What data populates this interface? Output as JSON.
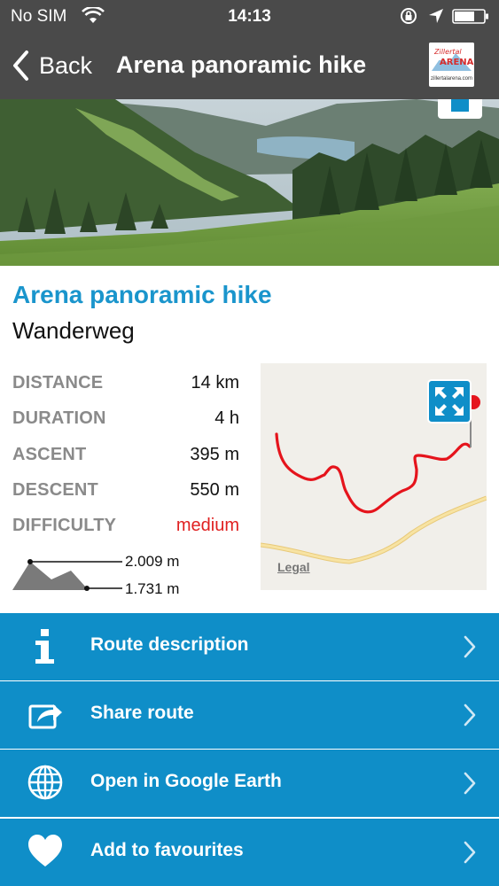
{
  "status_bar": {
    "carrier": "No SIM",
    "time": "14:13",
    "icons": [
      "wifi-icon",
      "orientation-lock-icon",
      "location-arrow-icon",
      "battery-icon"
    ]
  },
  "nav": {
    "back_label": "Back",
    "title": "Arena panoramic hike",
    "logo_text": "zillertalarena.com",
    "logo_wordmark": "Zillertal ARENA"
  },
  "route": {
    "title": "Arena panoramic hike",
    "type": "Wanderweg"
  },
  "stats": [
    {
      "label": "DISTANCE",
      "value": "14 km"
    },
    {
      "label": "DURATION",
      "value": "4 h"
    },
    {
      "label": "ASCENT",
      "value": "395 m"
    },
    {
      "label": "DESCENT",
      "value": "550 m"
    },
    {
      "label": "DIFFICULTY",
      "value": "medium"
    }
  ],
  "elevation": {
    "max": "2.009 m",
    "min": "1.731 m"
  },
  "map": {
    "legal_label": "Legal",
    "route_color": "#e5141c",
    "road_color": "#f3d689"
  },
  "actions": [
    {
      "label": "Route description",
      "icon": "info-icon"
    },
    {
      "label": "Share route",
      "icon": "share-icon"
    },
    {
      "label": "Open in Google Earth",
      "icon": "globe-icon"
    },
    {
      "label": "Add to favourites",
      "icon": "heart-icon"
    }
  ],
  "colors": {
    "accent": "#1a95cc",
    "action_background": "#0f8ec8",
    "nav_background": "#4a4a4a",
    "difficulty_medium": "#e02020"
  }
}
